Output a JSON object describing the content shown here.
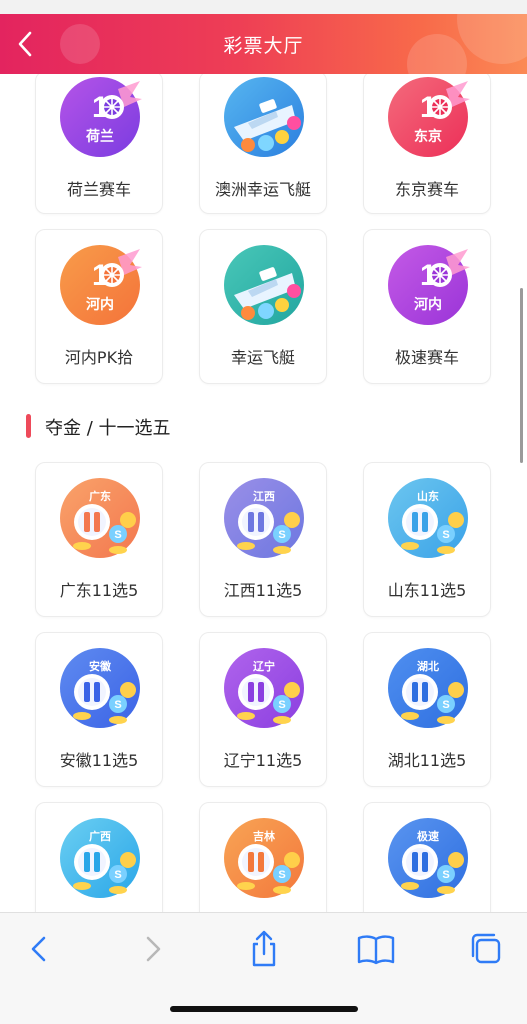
{
  "header": {
    "title": "彩票大厅",
    "back_icon": "chevron-left-icon"
  },
  "games_top": [
    {
      "name": "荷兰赛车",
      "badge_main": "10",
      "badge_sub": "荷兰",
      "color": "#7b3ce0",
      "color2": "#b554e8",
      "kind": "race"
    },
    {
      "name": "澳洲幸运飞艇",
      "badge_main": "",
      "badge_sub": "",
      "color": "#2b7fdf",
      "color2": "#57b6f0",
      "kind": "boat"
    },
    {
      "name": "东京赛车",
      "badge_main": "10",
      "badge_sub": "东京",
      "color": "#ec2f58",
      "color2": "#f46b7c",
      "kind": "race"
    },
    {
      "name": "河内PK拾",
      "badge_main": "10",
      "badge_sub": "河内",
      "color": "#f4733a",
      "color2": "#f89c4a",
      "kind": "race"
    },
    {
      "name": "幸运飞艇",
      "badge_main": "",
      "badge_sub": "",
      "color": "#22a6a0",
      "color2": "#49c7b8",
      "kind": "boat"
    },
    {
      "name": "极速赛车",
      "badge_main": "10",
      "badge_sub": "河内",
      "color": "#9a34d8",
      "color2": "#c45ae6",
      "kind": "race"
    }
  ],
  "section": {
    "title": "夺金 / 十一选五",
    "accent": "#ee4a5a"
  },
  "games_bottom": [
    {
      "name": "广东11选5",
      "badge_sub": "广东",
      "color": "#f3774f",
      "color2": "#f9a36a",
      "kind": "ball"
    },
    {
      "name": "江西11选5",
      "badge_sub": "江西",
      "color": "#6d77e0",
      "color2": "#9a8fe8",
      "kind": "ball"
    },
    {
      "name": "山东11选5",
      "badge_sub": "山东",
      "color": "#3aa2e8",
      "color2": "#6cc6ef",
      "kind": "ball"
    },
    {
      "name": "安徽11选5",
      "badge_sub": "安徽",
      "color": "#3b63e6",
      "color2": "#5f8bf0",
      "kind": "ball"
    },
    {
      "name": "辽宁11选5",
      "badge_sub": "辽宁",
      "color": "#8b3fe0",
      "color2": "#b064ec",
      "kind": "ball"
    },
    {
      "name": "湖北11选5",
      "badge_sub": "湖北",
      "color": "#2f6fe0",
      "color2": "#4f8ff0",
      "kind": "ball"
    },
    {
      "name": "",
      "badge_sub": "广西",
      "color": "#2aa6e8",
      "color2": "#6bcff2",
      "kind": "ball"
    },
    {
      "name": "",
      "badge_sub": "吉林",
      "color": "#f3783c",
      "color2": "#f8a455",
      "kind": "ball"
    },
    {
      "name": "",
      "badge_sub": "极速",
      "color": "#2f6fe0",
      "color2": "#5a95f0",
      "kind": "ball"
    }
  ],
  "toolbar": {
    "back": "chevron-left-icon",
    "forward": "chevron-right-icon",
    "share": "share-icon",
    "bookmarks": "book-icon",
    "tabs": "tabs-icon"
  }
}
